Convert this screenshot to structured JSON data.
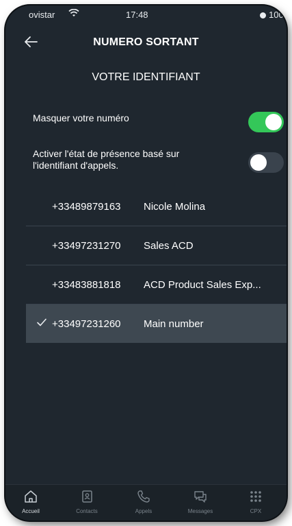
{
  "status_bar": {
    "carrier": "ovistar",
    "time": "17:48",
    "battery": "100 %"
  },
  "header": {
    "title": "NUMERO SORTANT",
    "back_icon": "arrow-left-icon"
  },
  "section": {
    "title": "VOTRE IDENTIFIANT"
  },
  "settings": {
    "hide_number": {
      "label": "Masquer votre numéro",
      "enabled": true
    },
    "presence": {
      "label": "Activer l'état de présence basé sur l'identifiant d'appels.",
      "enabled": false
    }
  },
  "numbers": [
    {
      "number": "+33489879163",
      "name": "Nicole Molina",
      "selected": false
    },
    {
      "number": "+33497231270",
      "name": "Sales ACD",
      "selected": false
    },
    {
      "number": "+33483881818",
      "name": "ACD Product Sales Exp...",
      "selected": false
    },
    {
      "number": "+33497231260",
      "name": "Main number",
      "selected": true
    }
  ],
  "tabbar": {
    "items": [
      {
        "label": "Accueil",
        "icon": "home-icon"
      },
      {
        "label": "Contacts",
        "icon": "contacts-icon"
      },
      {
        "label": "Appels",
        "icon": "phone-icon"
      },
      {
        "label": "Messages",
        "icon": "messages-icon"
      },
      {
        "label": "CPX",
        "icon": "grid-icon"
      }
    ]
  },
  "colors": {
    "background": "#1f272f",
    "toggle_on": "#34c759",
    "toggle_off": "#3a434d",
    "selected_row": "#3e4851"
  }
}
